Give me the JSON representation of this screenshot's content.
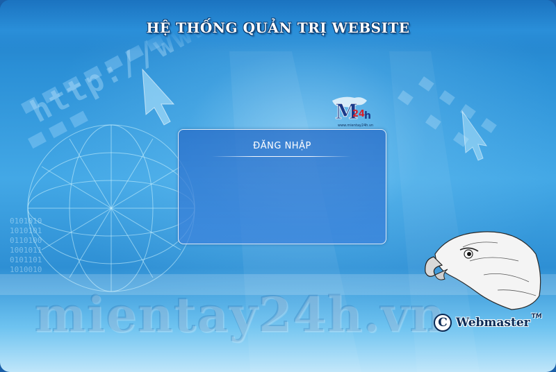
{
  "header": {
    "title": "HỆ THỐNG QUẢN TRỊ WEBSITE"
  },
  "background": {
    "url_fragment": "http://www",
    "watermark": "mientay24h.vn",
    "binary_digits": [
      "0101010",
      "1010101",
      "0110100",
      "1001011",
      "0101101",
      "1010010"
    ]
  },
  "logo": {
    "letter": "M",
    "number": "24",
    "suffix": "h",
    "domain": "www.mientay24h.vn"
  },
  "login": {
    "title": "ĐĂNG NHẬP"
  },
  "badge": {
    "copyright_symbol": "C",
    "label": "Webmaster",
    "trademark": "TM"
  },
  "colors": {
    "background": "#2a8fd6",
    "title_text": "#ffffff",
    "panel": "#2e6fc8",
    "badge_text": "#0b2a55"
  }
}
